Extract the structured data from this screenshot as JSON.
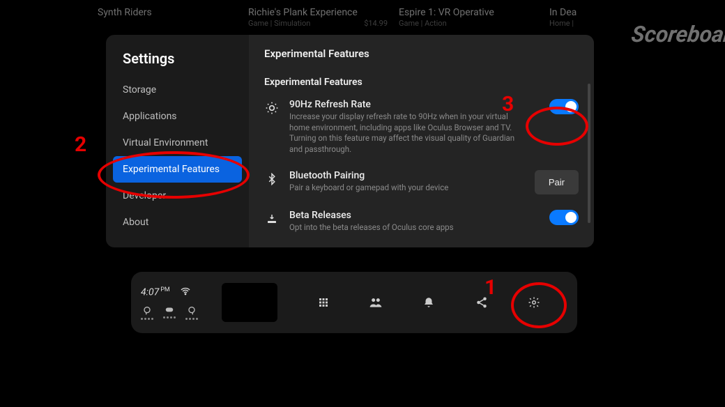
{
  "bg_shelf": {
    "tiles": [
      {
        "title": "Synth Riders",
        "sub": "",
        "price": ""
      },
      {
        "title": "Richie's Plank Experience",
        "sub": "Game | Simulation",
        "price": "$14.99"
      },
      {
        "title": "Espire 1: VR Operative",
        "sub": "Game | Action",
        "price": ""
      },
      {
        "title": "In Dea",
        "sub": "Home |",
        "price": ""
      }
    ],
    "scoreboard": "Scoreboar"
  },
  "settings": {
    "title": "Settings",
    "sidebar": [
      {
        "label": "Storage"
      },
      {
        "label": "Applications"
      },
      {
        "label": "Virtual Environment"
      },
      {
        "label": "Experimental Features",
        "active": true
      },
      {
        "label": "Developer"
      },
      {
        "label": "About"
      }
    ],
    "content": {
      "page_title": "Experimental Features",
      "section_title": "Experimental Features",
      "features": [
        {
          "icon": "brightness-icon",
          "name": "90Hz Refresh Rate",
          "desc": "Increase your display refresh rate to 90Hz when in your virtual home environment, including apps like Oculus Browser and TV. Turning on this feature may affect the visual quality of Guardian and passthrough.",
          "control": "toggle",
          "state": "on"
        },
        {
          "icon": "bluetooth-icon",
          "name": "Bluetooth Pairing",
          "desc": "Pair a keyboard or gamepad with your device",
          "control": "button",
          "button_label": "Pair"
        },
        {
          "icon": "download-icon",
          "name": "Beta Releases",
          "desc": "Opt into the beta releases of Oculus core apps",
          "control": "toggle",
          "state": "on"
        }
      ]
    }
  },
  "dock": {
    "time": "4:07",
    "ampm": "PM",
    "nav": [
      {
        "name": "apps-icon"
      },
      {
        "name": "people-icon"
      },
      {
        "name": "bell-icon"
      },
      {
        "name": "share-icon"
      },
      {
        "name": "gear-icon"
      }
    ]
  },
  "annotations": {
    "n1": "1",
    "n2": "2",
    "n3": "3"
  }
}
